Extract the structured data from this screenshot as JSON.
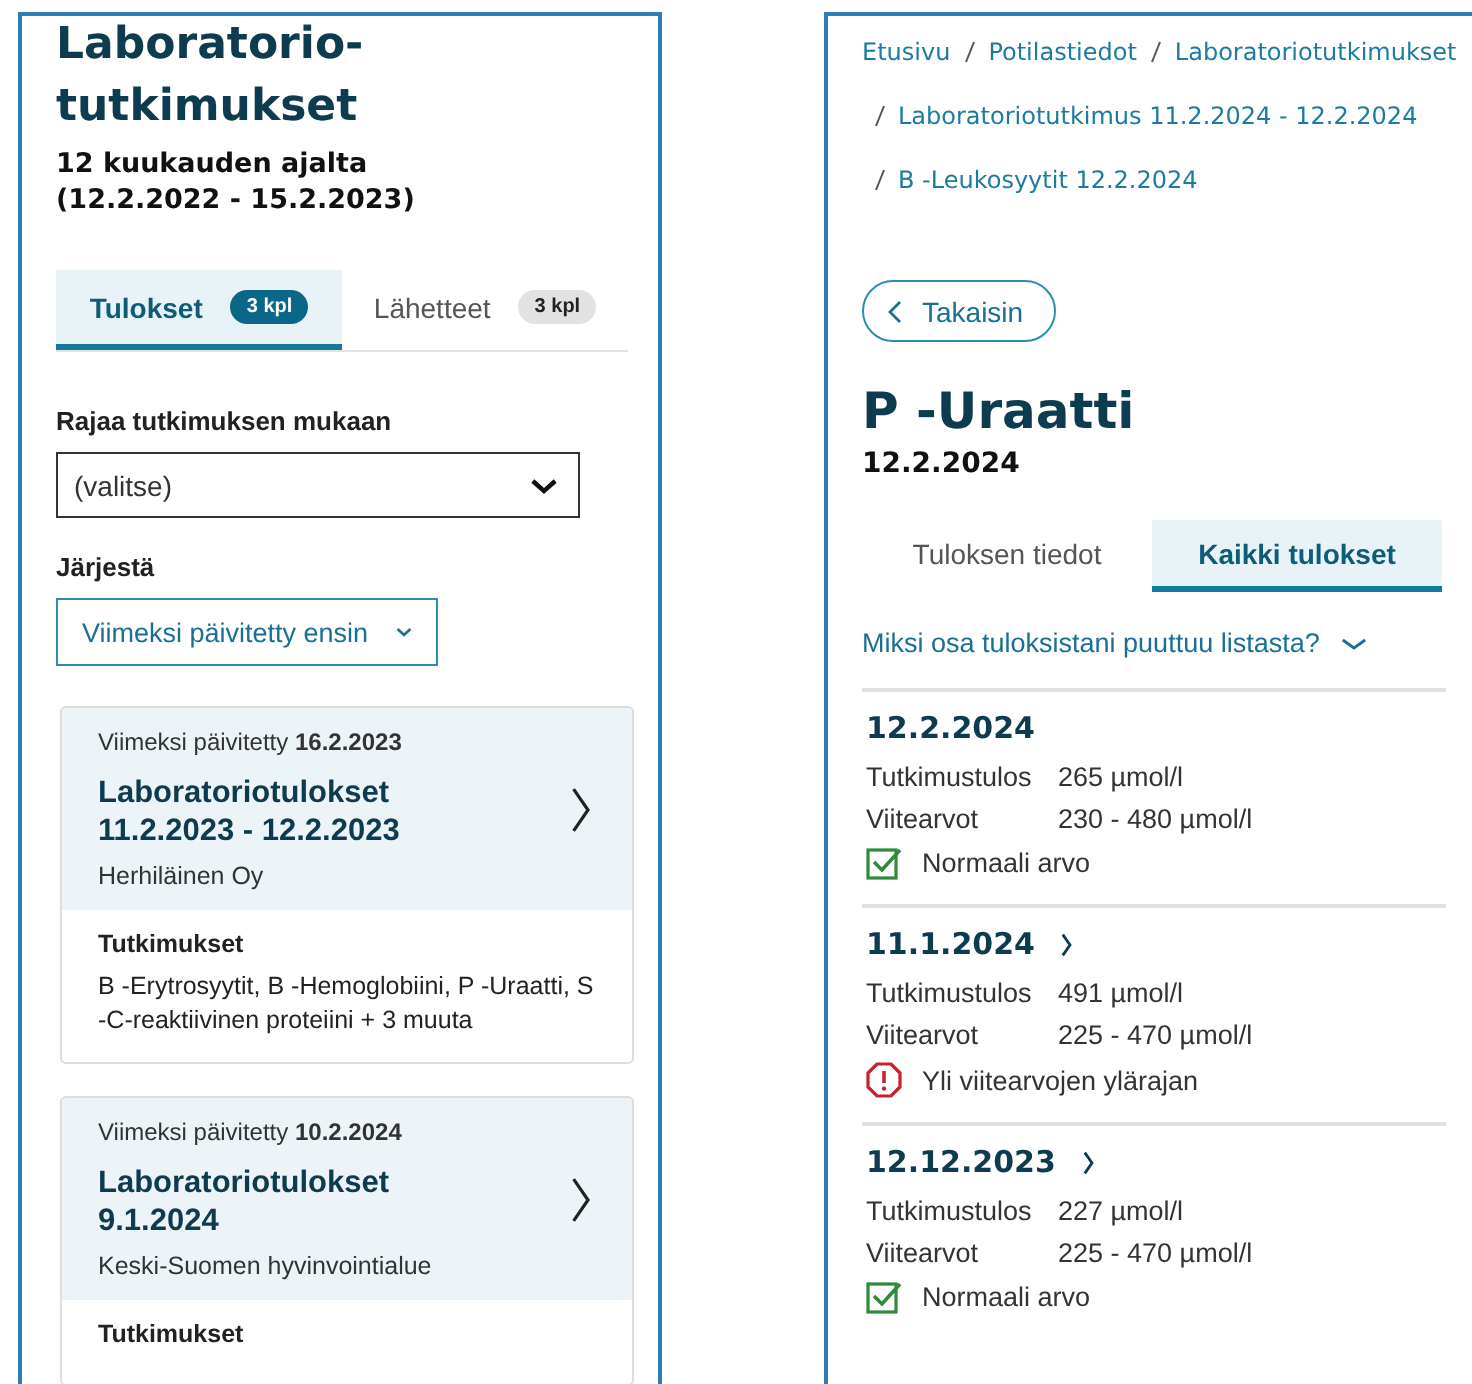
{
  "list_view": {
    "title": "Laboratorio-tutkimukset",
    "period_label": "12 kuukauden ajalta",
    "period_range": "(12.2.2022 - 15.2.2023)",
    "tabs": [
      {
        "label": "Tulokset",
        "count": "3 kpl",
        "selected": true
      },
      {
        "label": "Lähetteet",
        "count": "3 kpl",
        "selected": false
      }
    ],
    "filter": {
      "label": "Rajaa tutkimuksen mukaan",
      "value": "(valitse)"
    },
    "sort": {
      "label": "Järjestä",
      "value": "Viimeksi päivitetty ensin"
    },
    "cards": [
      {
        "updated": "Viimeksi päivitetty **16.2.2023**",
        "title": "Laboratoriotulokset 11.2.2023 - 12.2.2023",
        "provider": "Herhiläinen Oy",
        "tests_heading": "Tutkimukset",
        "tests": "B -Erytrosyytit, B -Hemoglobiini, P -Uraatti, S -C-reaktiivinen proteiini + 3 muuta"
      },
      {
        "updated": "Viimeksi päivitetty **10.2.2024**",
        "title": "Laboratoriotulokset 9.1.2024",
        "provider": "Keski-Suomen hyvinvointialue",
        "tests_heading": "Tutkimukset"
      }
    ]
  },
  "detail_view": {
    "breadcrumbs": [
      "Etusivu",
      "Potilastiedot",
      "Laboratoriotutkimukset",
      "Laboratoriotutkimus 11.2.2024 - 12.2.2024",
      "B -Leukosyytit 12.2.2024"
    ],
    "back_button": "Takaisin",
    "title": "P -Uraatti",
    "date": "12.2.2024",
    "tabs": [
      {
        "label": "Tuloksen tiedot",
        "selected": false
      },
      {
        "label": "Kaikki tulokset",
        "selected": true
      }
    ],
    "disclosure": {
      "label": "Miksi osa tuloksistani puuttuu listasta?",
      "expanded": false
    },
    "results": [
      {
        "date": "12.2.2024",
        "has_link": false,
        "result_label": "Tutkimustulos",
        "result": "265 µmol/l",
        "range_label": "Viitearvot",
        "range": "230 - 480 µmol/l",
        "kind": "normal",
        "status_text": "Normaali arvo"
      },
      {
        "date": "11.1.2024",
        "has_link": true,
        "result_label": "Tutkimustulos",
        "result": "491 µmol/l",
        "range_label": "Viitearvot",
        "range": "225 - 470 µmol/l",
        "kind": "high",
        "status_text": "Yli viitearvojen ylärajan"
      },
      {
        "date": "12.12.2023",
        "has_link": true,
        "result_label": "Tutkimustulos",
        "result": "227 µmol/l",
        "range_label": "Viitearvot",
        "range": "225 - 470 µmol/l",
        "kind": "normal",
        "status_text": "Normaali arvo"
      }
    ]
  }
}
